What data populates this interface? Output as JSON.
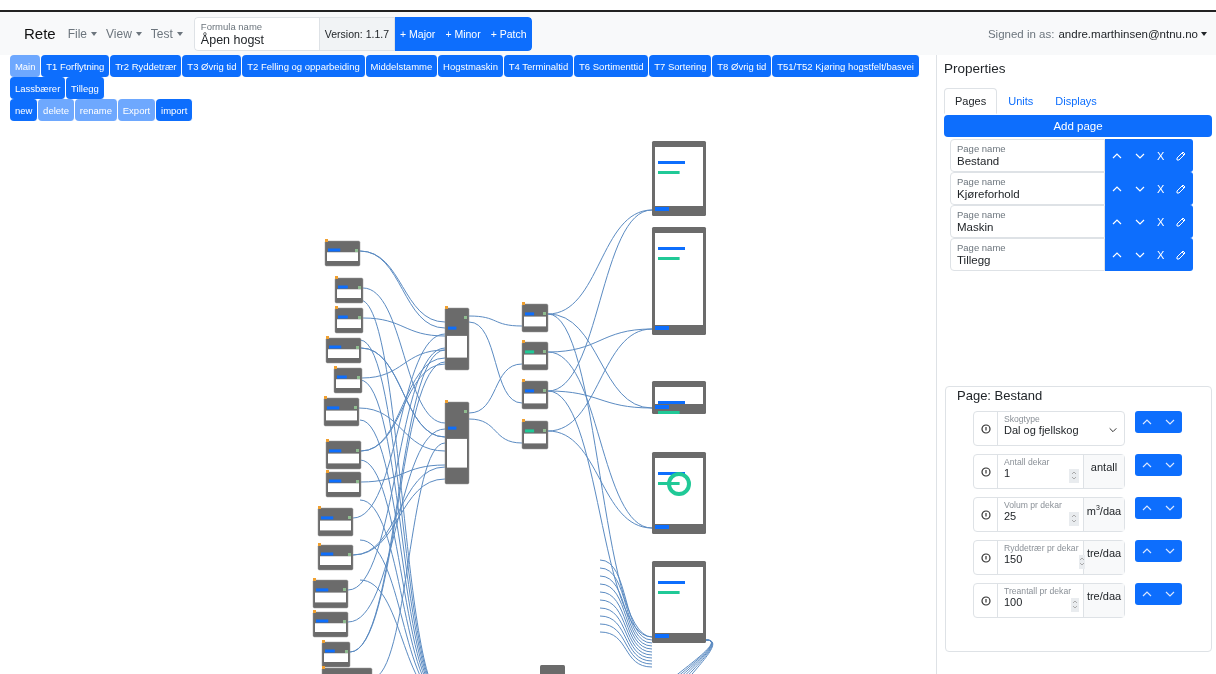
{
  "navbar": {
    "brand": "Rete",
    "menus": [
      {
        "label": "File"
      },
      {
        "label": "View"
      },
      {
        "label": "Test"
      }
    ],
    "formula_name": {
      "label": "Formula name",
      "value": "Åpen hogst"
    },
    "version": "Version: 1.1.7",
    "version_buttons": [
      "+ Major",
      "+ Minor",
      "+ Patch"
    ],
    "signed_in": {
      "label": "Signed in as:",
      "user": "andre.marthinsen@ntnu.no"
    }
  },
  "tabs": [
    {
      "label": "Main",
      "selected": true
    },
    {
      "label": "T1 Forflytning",
      "selected": false
    },
    {
      "label": "Tr2 Ryddetrær",
      "selected": false
    },
    {
      "label": "T3 Øvrig tid",
      "selected": false
    },
    {
      "label": "T2 Felling og opparbeiding",
      "selected": false
    },
    {
      "label": "Middelstamme",
      "selected": false
    },
    {
      "label": "Hogstmaskin",
      "selected": false
    },
    {
      "label": "T4 Terminaltid",
      "selected": false
    },
    {
      "label": "T6 Sortimenttid",
      "selected": false
    },
    {
      "label": "T7 Sortering",
      "selected": false
    },
    {
      "label": "T8 Øvrig tid",
      "selected": false
    },
    {
      "label": "T51/T52 Kjøring hogstfelt/basvei",
      "selected": false
    },
    {
      "label": "Lassbærer",
      "selected": false
    },
    {
      "label": "Tillegg",
      "selected": false
    }
  ],
  "actions": [
    {
      "label": "new",
      "disabled": false
    },
    {
      "label": "delete",
      "disabled": true
    },
    {
      "label": "rename",
      "disabled": true
    },
    {
      "label": "Export",
      "disabled": true
    },
    {
      "label": "import",
      "disabled": false
    }
  ],
  "properties": {
    "title": "Properties",
    "tabs": [
      {
        "label": "Pages",
        "selected": true
      },
      {
        "label": "Units",
        "selected": false
      },
      {
        "label": "Displays",
        "selected": false
      }
    ],
    "add_button": "Add page",
    "pages": [
      {
        "label": "Page name",
        "name": "Bestand",
        "delete_label": "X"
      },
      {
        "label": "Page name",
        "name": "Kjøreforhold",
        "delete_label": "X"
      },
      {
        "label": "Page name",
        "name": "Maskin",
        "delete_label": "X"
      },
      {
        "label": "Page name",
        "name": "Tillegg",
        "delete_label": "X"
      }
    ]
  },
  "page_editor": {
    "title": "Page: Bestand",
    "fields": [
      {
        "kind": "select",
        "label": "Skogtype",
        "value": "Dal og fjellskog"
      },
      {
        "kind": "number",
        "label": "Antall dekar",
        "value": "1",
        "unit": "antall"
      },
      {
        "kind": "number",
        "label": "Volum pr dekar",
        "value": "25",
        "unit": "m$^{3}$/daa"
      },
      {
        "kind": "number",
        "label": "Ryddetrær pr dekar",
        "value": "150",
        "unit": "tre/daa"
      },
      {
        "kind": "number",
        "label": "Treantall pr dekar",
        "value": "100",
        "unit": "tre/daa"
      }
    ]
  }
}
